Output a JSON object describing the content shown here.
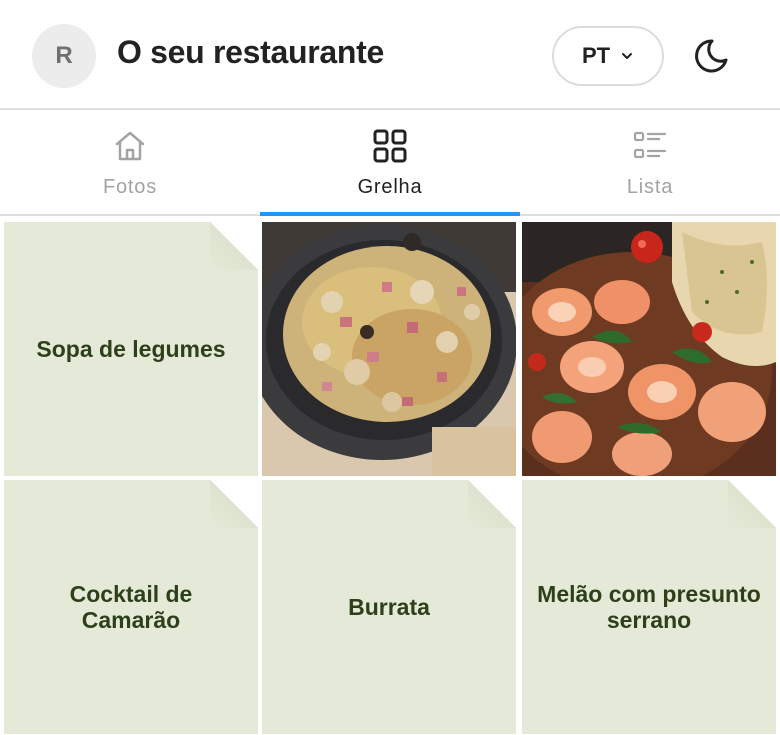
{
  "header": {
    "avatar_initial": "R",
    "title": "O seu restaurante",
    "language": "PT",
    "theme_icon": "moon-icon"
  },
  "tabs": [
    {
      "label": "Fotos",
      "icon": "home-icon",
      "active": false
    },
    {
      "label": "Grelha",
      "icon": "grid-icon",
      "active": true
    },
    {
      "label": "Lista",
      "icon": "list-icon",
      "active": false
    }
  ],
  "grid": {
    "items": [
      {
        "type": "text",
        "name": "Sopa de legumes"
      },
      {
        "type": "photo",
        "name": ""
      },
      {
        "type": "photo",
        "name": ""
      },
      {
        "type": "text",
        "name": "Cocktail de Camarão"
      },
      {
        "type": "text",
        "name": "Burrata"
      },
      {
        "type": "text",
        "name": "Melão com presunto serrano"
      }
    ]
  },
  "colors": {
    "accent": "#2196f3",
    "card_bg": "#e5ead8",
    "card_text": "#2d401a",
    "inactive_tab": "#a3a3a3"
  }
}
